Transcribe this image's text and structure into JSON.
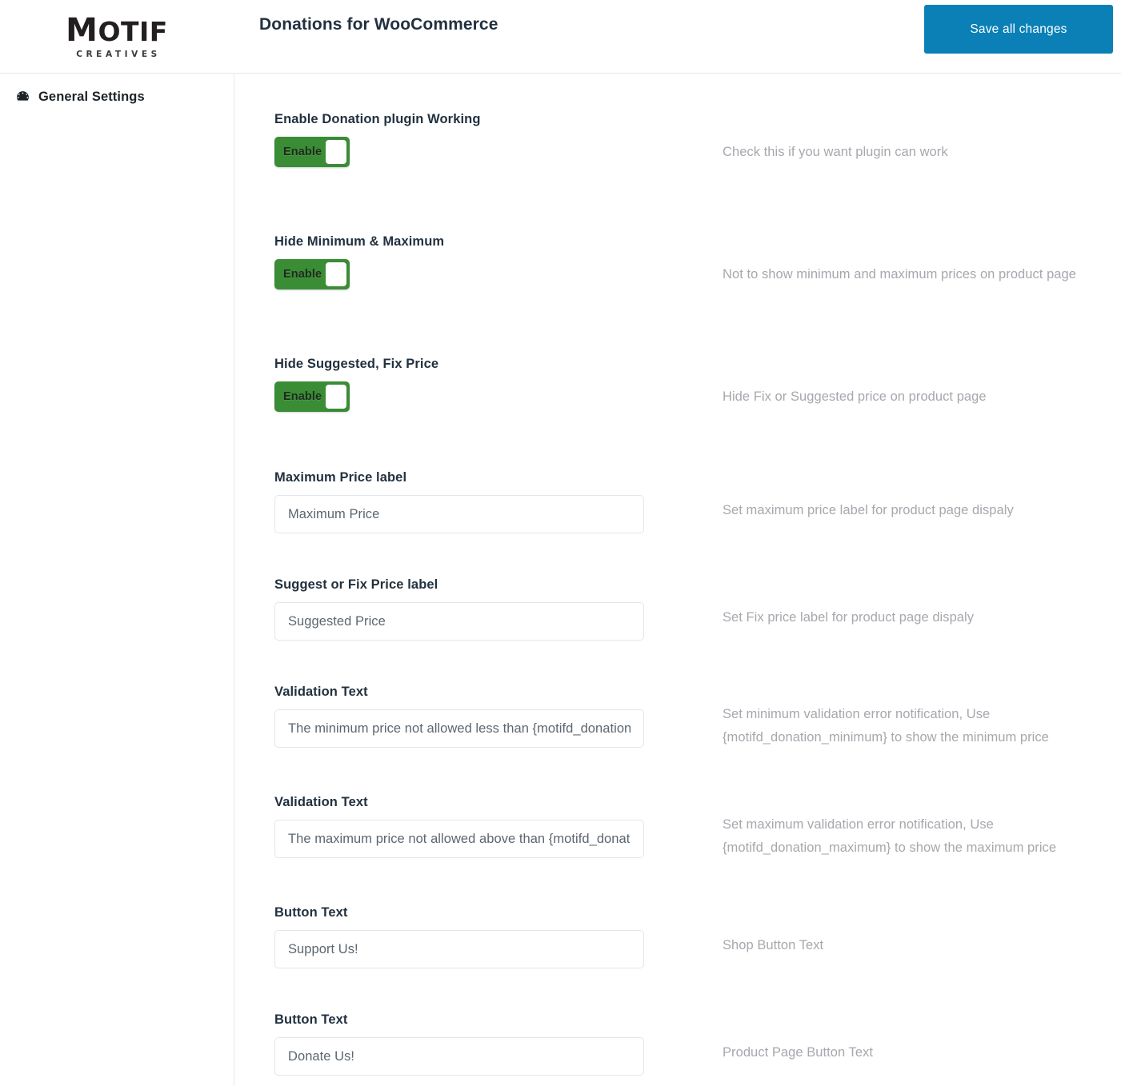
{
  "brand": {
    "name_lead": "M",
    "name_rest": "OTIF",
    "tagline": "CREATIVES"
  },
  "header": {
    "title": "Donations for WooCommerce",
    "save_label": "Save all changes",
    "accent_color": "#0b80b6"
  },
  "sidebar": {
    "items": [
      {
        "label": "General Settings",
        "icon": "dashboard-gauge-icon"
      }
    ]
  },
  "toggle": {
    "on_label": "Enable",
    "on_color": "#3a8c35"
  },
  "settings": [
    {
      "label": "Enable Donation plugin Working",
      "type": "toggle",
      "value": "Enable",
      "help": "Check this if you want plugin can work"
    },
    {
      "label": "Hide Minimum & Maximum",
      "type": "toggle",
      "value": "Enable",
      "help": "Not to show minimum and maximum prices on product page"
    },
    {
      "label": "Hide Suggested, Fix Price",
      "type": "toggle",
      "value": "Enable",
      "help": "Hide Fix or Suggested price on product page"
    },
    {
      "label": "Maximum Price label",
      "type": "text",
      "value": "Maximum Price",
      "placeholder": "Maximum Price",
      "help": "Set maximum price label for product page dispaly"
    },
    {
      "label": "Suggest or Fix Price label",
      "type": "text",
      "value": "Suggested Price",
      "placeholder": "Suggested Price",
      "help": "Set Fix price label for product page dispaly"
    },
    {
      "label": "Validation Text",
      "type": "text",
      "value": "The minimum price not allowed less than {motifd_donation_minimum}",
      "placeholder": "The minimum price not allowed less than {motifd_donation_minimum}",
      "help": "Set minimum validation error notification, Use {motifd_donation_minimum} to show the minimum price"
    },
    {
      "label": "Validation Text",
      "type": "text",
      "value": "The maximum price not allowed above than {motifd_donation_maximum}",
      "placeholder": "The maximum price not allowed above than {motifd_donation_maximum}",
      "help": "Set maximum validation error notification, Use {motifd_donation_maximum} to show the maximum price"
    },
    {
      "label": "Button Text",
      "type": "text",
      "value": "Support Us!",
      "placeholder": "Support Us!",
      "help": "Shop Button Text"
    },
    {
      "label": "Button Text",
      "type": "text",
      "value": "Donate Us!",
      "placeholder": "Donate Us!",
      "help": "Product Page Button Text"
    }
  ]
}
